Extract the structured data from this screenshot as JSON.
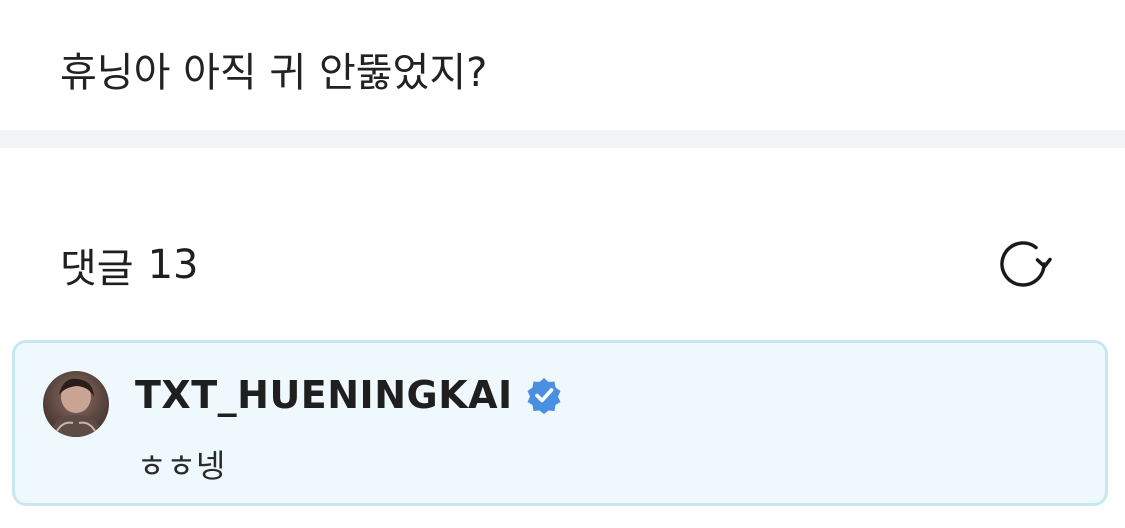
{
  "post": {
    "text": "휴닝아 아직 귀 안뚫었지?"
  },
  "comments": {
    "label": "댓글",
    "count": "13",
    "refresh_icon": "refresh-icon"
  },
  "comment_list": [
    {
      "author": "TXT_HUENINGKAI",
      "verified_icon": "verified-badge-icon",
      "text": "ㅎㅎ넹",
      "highlight_color": "#eef8fd"
    }
  ],
  "colors": {
    "verified_blue": "#4a90e2",
    "card_border": "#c9e6f3"
  }
}
